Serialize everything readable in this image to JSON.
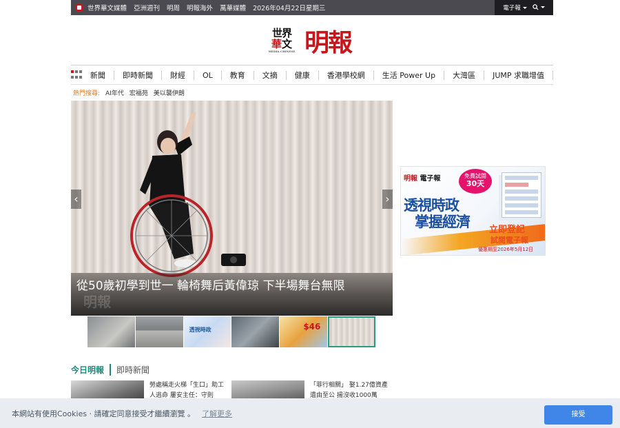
{
  "topbar": {
    "links": [
      "世界華文媒體",
      "亞洲週刊",
      "明周",
      "明報海外",
      "萬華媒體",
      "2026年04月22日星期三"
    ],
    "epaper": "電子報",
    "search_icon": "search-icon"
  },
  "masthead": {
    "group_logo_line1": "世界",
    "group_logo_line2_red": "華",
    "group_logo_line2": "文",
    "group_logo_small": "MEDIA CHINESE",
    "title": "明報"
  },
  "nav": {
    "items": [
      "新聞",
      "即時新聞",
      "財經",
      "OL",
      "教育",
      "文摘",
      "健康",
      "香港學校網",
      "生活 Power Up",
      "大灣區",
      "JUMP 求職增值"
    ]
  },
  "hot": {
    "label": "熱門搜尋:",
    "keywords": [
      "AI年代",
      "宏福苑",
      "美以襲伊朗"
    ]
  },
  "slider": {
    "caption": "從50歲初學到世一 輪椅舞后黃偉琼 下半場舞台無限",
    "watermark": "明報",
    "prev": "‹",
    "next": "›",
    "thumb_texts": [
      "",
      "",
      "透視時政",
      "",
      "$46",
      ""
    ]
  },
  "ad": {
    "brand_red": "明報",
    "brand_black": " 電子報",
    "badge_line1": "免費試閱",
    "badge_line2": "30天",
    "headline1": "透視時政",
    "headline2": "掌握經濟",
    "cta1": "立即登記",
    "cta2": "試閱電子報",
    "note": "優惠期至2026年5月12日"
  },
  "tabs": {
    "active": "今日明報",
    "inactive": "即時新聞"
  },
  "cards": [
    {
      "text": "勞處稱走火梯「生口」助工人逃命 屢安主任：守則"
    },
    {
      "text": "「菲行相關」 娶1.27億資產遺由至公 揚沒收1000萬"
    }
  ],
  "cookie": {
    "message": "本網站有使用Cookies · 請確定同意接受才繼續瀏覽 。",
    "more": "了解更多",
    "accept": "接受"
  }
}
